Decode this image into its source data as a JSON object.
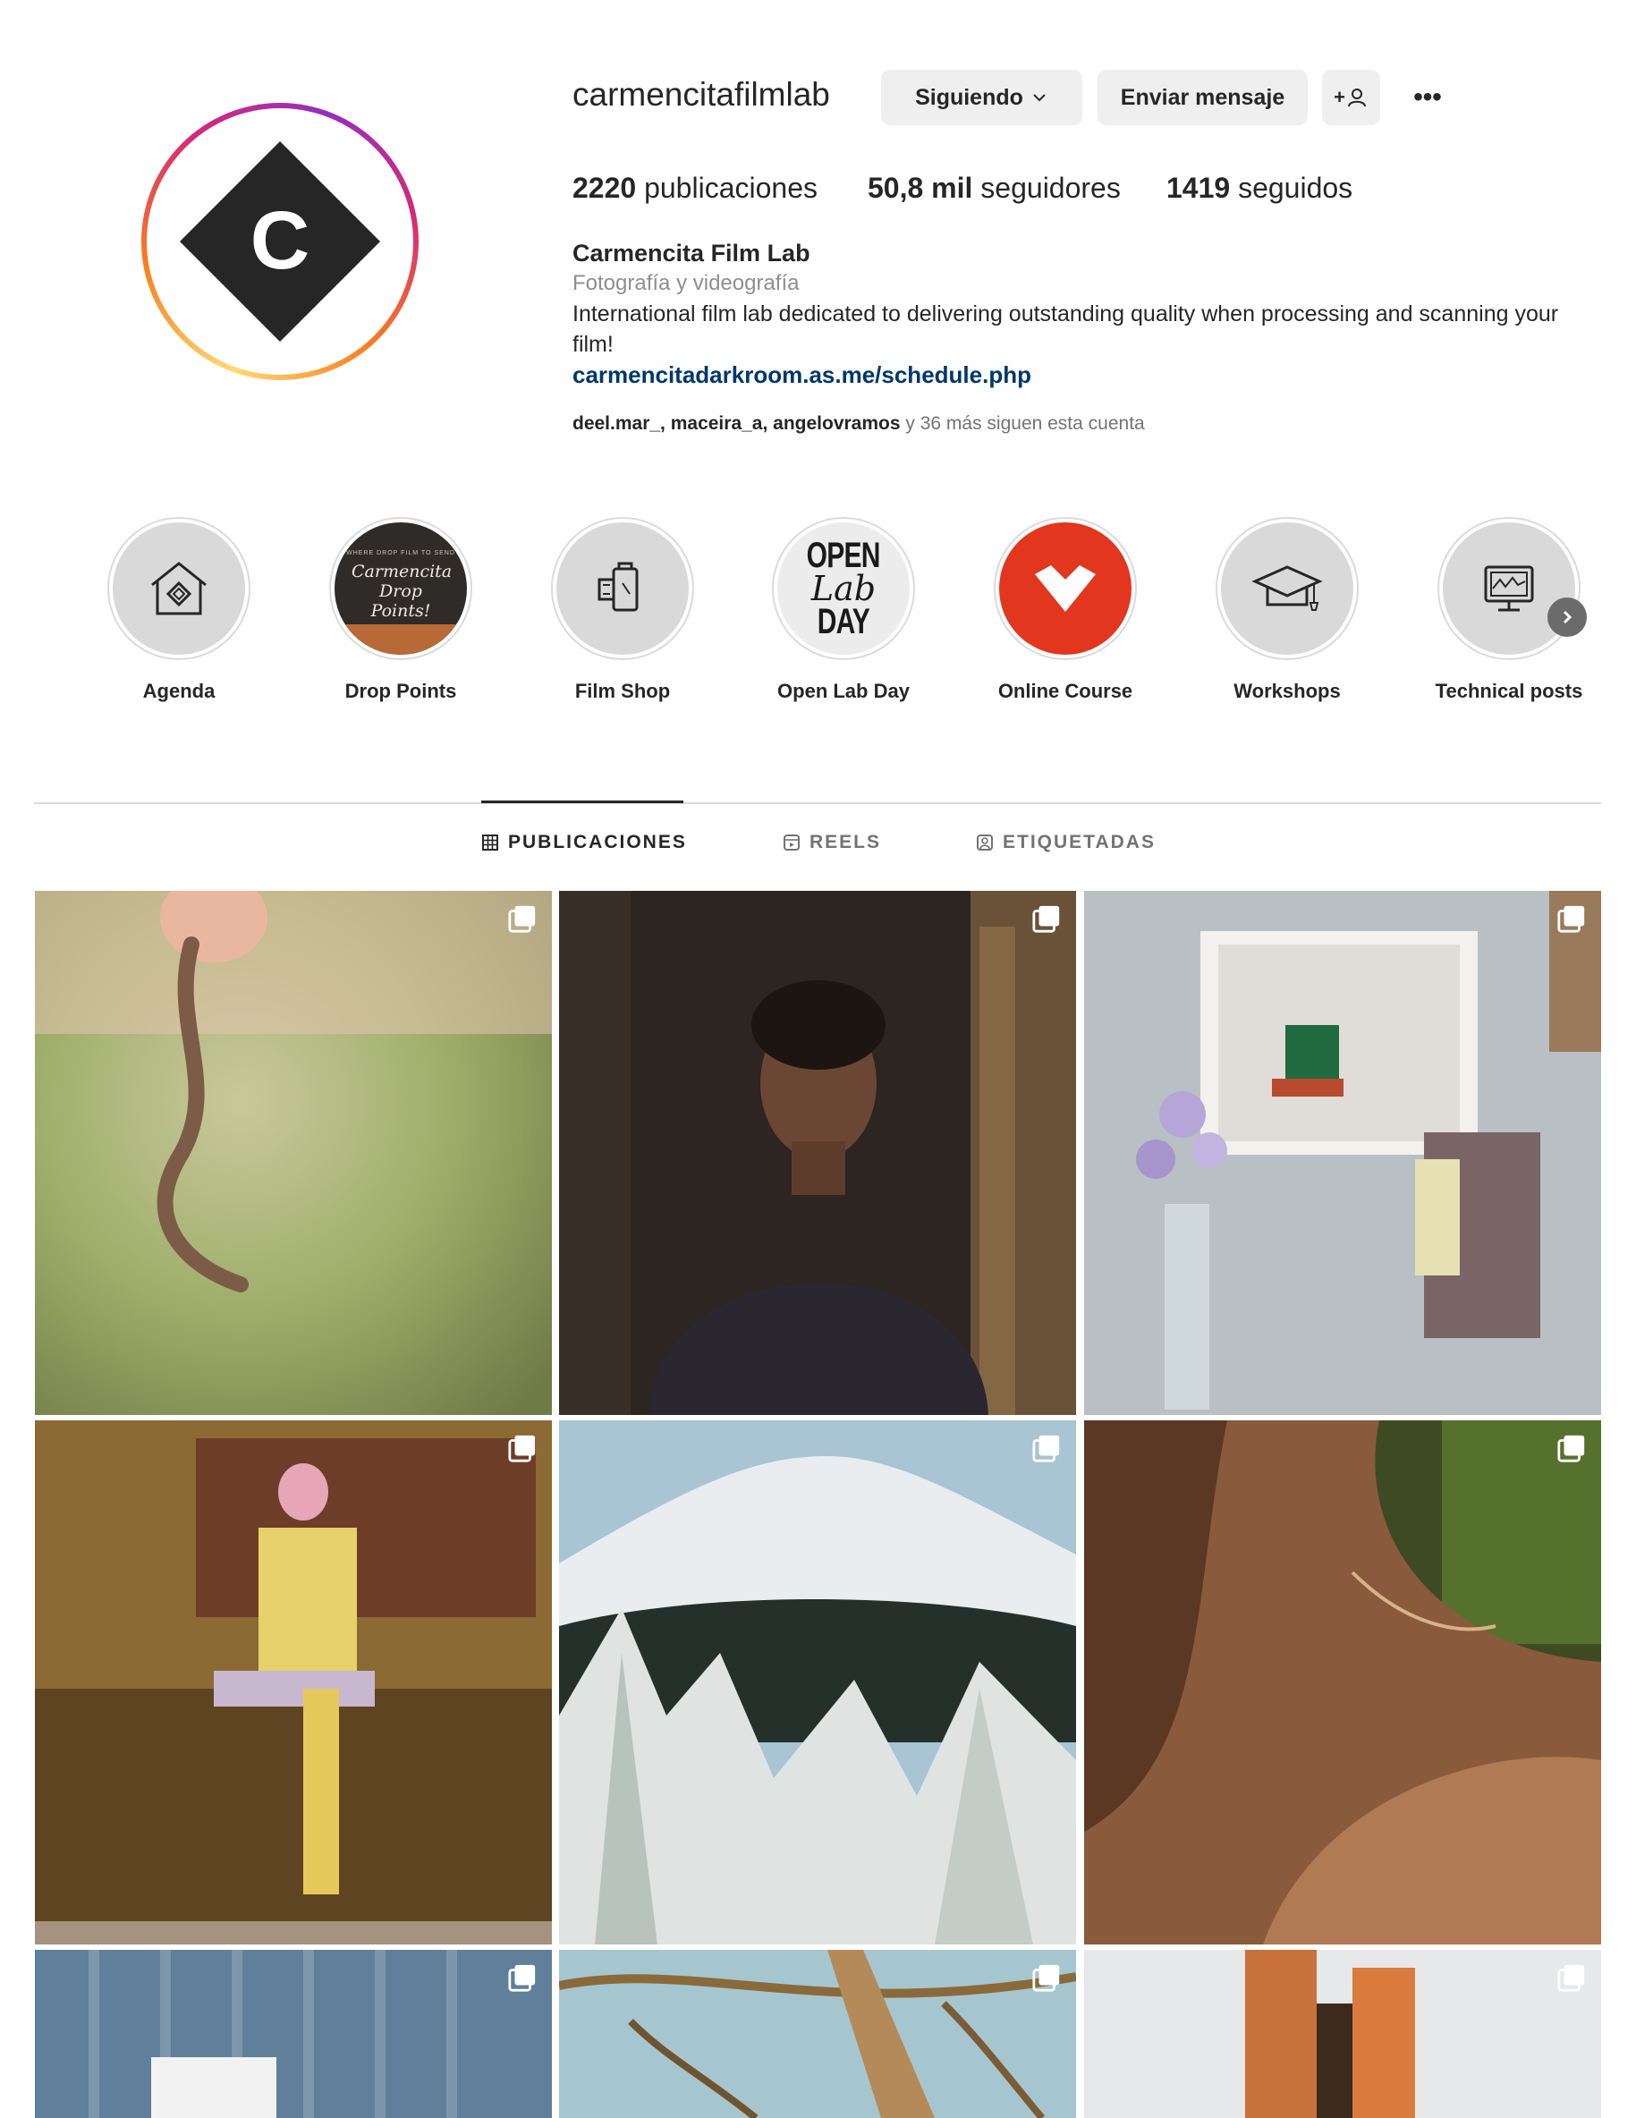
{
  "profile": {
    "username": "carmencitafilmlab",
    "following_button": "Siguiendo",
    "message_button": "Enviar mensaje",
    "suggest_icon": "add-person-icon",
    "more_icon": "more-options-icon",
    "more_glyph": "•••",
    "suggest_glyph": "+",
    "stats": {
      "posts_count": "2220",
      "posts_label": "publicaciones",
      "followers_count": "50,8 mil",
      "followers_label": "seguidores",
      "following_count": "1419",
      "following_label": "seguidos"
    },
    "full_name": "Carmencita Film Lab",
    "category": "Fotografía y videografía",
    "bio": "International film lab dedicated to delivering outstanding quality when processing and scanning your film!",
    "link": "carmencitadarkroom.as.me/schedule.php",
    "followed_by_names": "deel.mar_, maceira_a, angelovramos",
    "followed_by_rest": " y 36 más siguen esta cuenta",
    "avatar_letter": "C"
  },
  "highlights": [
    {
      "label": "Agenda",
      "icon": "house-icon"
    },
    {
      "label": "Drop Points",
      "icon": "drop-points-cover",
      "cover_title": "Carmencita Drop Points!",
      "cover_caption": "WHERE DROP FILM TO SEND"
    },
    {
      "label": "Film Shop",
      "icon": "film-canister-icon"
    },
    {
      "label": "Open Lab Day",
      "icon": "open-lab-day-cover",
      "cover_line1": "OPEN",
      "cover_line2": "Lab",
      "cover_line3": "DAY"
    },
    {
      "label": "Online Course",
      "icon": "red-logo-cover"
    },
    {
      "label": "Workshops",
      "icon": "graduation-cap-icon"
    },
    {
      "label": "Technical posts",
      "icon": "monitor-icon"
    }
  ],
  "tabs": [
    {
      "label": "PUBLICACIONES",
      "icon": "grid-icon",
      "active": true
    },
    {
      "label": "REELS",
      "icon": "reels-icon",
      "active": false
    },
    {
      "label": "ETIQUETADAS",
      "icon": "tagged-icon",
      "active": false
    }
  ],
  "colors": {
    "link": "#00376b",
    "button_bg": "#efefef",
    "secondary_text": "#8e8e8e",
    "online_course_red": "#e2361f"
  }
}
